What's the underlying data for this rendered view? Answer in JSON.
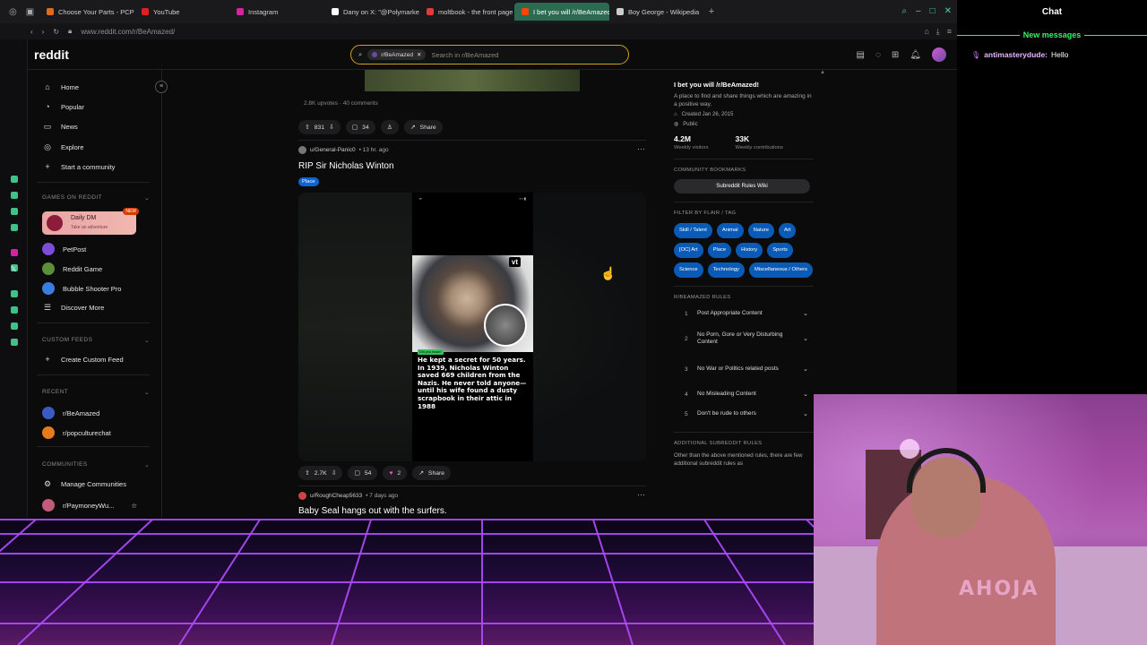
{
  "browser": {
    "tabs": [
      {
        "label": "Choose Your Parts - PCPa",
        "color": "#e26a1b"
      },
      {
        "label": "YouTube",
        "color": "#e02020"
      },
      {
        "label": "Instagram",
        "color": "#d6249f"
      },
      {
        "label": "Dany on X: \"@Polymarket",
        "color": "#ffffff"
      },
      {
        "label": "moltbook - the front page",
        "color": "#e03a3a"
      },
      {
        "label": "I bet you will /r/BeAmazed",
        "color": "#ff4500"
      },
      {
        "label": "Boy George - Wikipedia",
        "color": "#cccccc"
      }
    ],
    "url": "www.reddit.com/r/BeAmazed/"
  },
  "header": {
    "logo": "reddit",
    "search_chip": "r/BeAmazed",
    "search_placeholder": "Search in r/BeAmazed"
  },
  "nav": {
    "main": [
      "Home",
      "Popular",
      "News",
      "Explore",
      "Start a community"
    ],
    "games_header": "GAMES ON REDDIT",
    "daily_dm_title": "Daily DM",
    "daily_dm_sub": "Take an adventure",
    "daily_dm_badge": "NEW",
    "games": [
      "PetPost",
      "Reddit Game",
      "Bubble Shooter Pro",
      "Discover More"
    ],
    "feeds_header": "CUSTOM FEEDS",
    "create_feed": "Create Custom Feed",
    "recent_header": "RECENT",
    "recent": [
      "r/BeAmazed",
      "r/popculturechat"
    ],
    "communities_header": "COMMUNITIES",
    "manage": "Manage Communities",
    "community_partial": "r/PaymoneyWu..."
  },
  "feed": {
    "prev_meta": "2.8K upvotes · 40 comments",
    "prev_votes": "831",
    "prev_comments": "34",
    "share": "Share",
    "post": {
      "author": "u/General-Panic0",
      "age": "• 13 hr. ago",
      "title": "RIP Sir Nicholas Winton",
      "flair": "Place",
      "image_logo": "vt",
      "image_tag": "Did you know?",
      "image_text": "He kept a secret for 50 years. In 1939, Nicholas Winton saved 669 children from the Nazis. He never told anyone—until his wife found a dusty scrapbook in their attic in 1988",
      "votes": "2.7K",
      "comments": "54",
      "awards": "2"
    },
    "next": {
      "author": "u/RoughCheap5633",
      "age": "• 7 days ago",
      "title": "Baby Seal hangs out with the surfers."
    }
  },
  "sidebar": {
    "title": "I bet you will /r/BeAmazed!",
    "desc": "A place to find and share things which are amazing in a positive way.",
    "created": "Created Jan 26, 2015",
    "visibility": "Public",
    "visitors": "4.2M",
    "visitors_label": "Weekly visitors",
    "contribs": "33K",
    "contribs_label": "Weekly contributions",
    "bookmarks_header": "COMMUNITY BOOKMARKS",
    "bookmark": "Subreddit Rules Wiki",
    "flair_header": "FILTER BY FLAIR / TAG",
    "flairs": [
      "Skill / Talent",
      "Animal",
      "Nature",
      "Art",
      "[OC] Art",
      "Place",
      "History",
      "Sports",
      "Science",
      "Technology",
      "Miscellaneous / Others"
    ],
    "rules_header": "R/BEAMAZED RULES",
    "rules": [
      {
        "n": "1",
        "t": "Post Appropriate Content"
      },
      {
        "n": "2",
        "t": "No Porn, Gore or Very Disturbing Content"
      },
      {
        "n": "3",
        "t": "No War or Politics related posts"
      },
      {
        "n": "4",
        "t": "No Misleading Content"
      },
      {
        "n": "5",
        "t": "Don't be rude to others"
      }
    ],
    "add_rules_header": "ADDITIONAL SUBREDDIT RULES",
    "add_rules_text": "Other than the above mentioned rules, there are few additional subreddit rules as"
  },
  "chat": {
    "title": "Chat",
    "new_messages": "New messages",
    "user": "antimasterydude:",
    "message": "Hello"
  },
  "webcam": {
    "shirt_text": "AHOJA"
  }
}
